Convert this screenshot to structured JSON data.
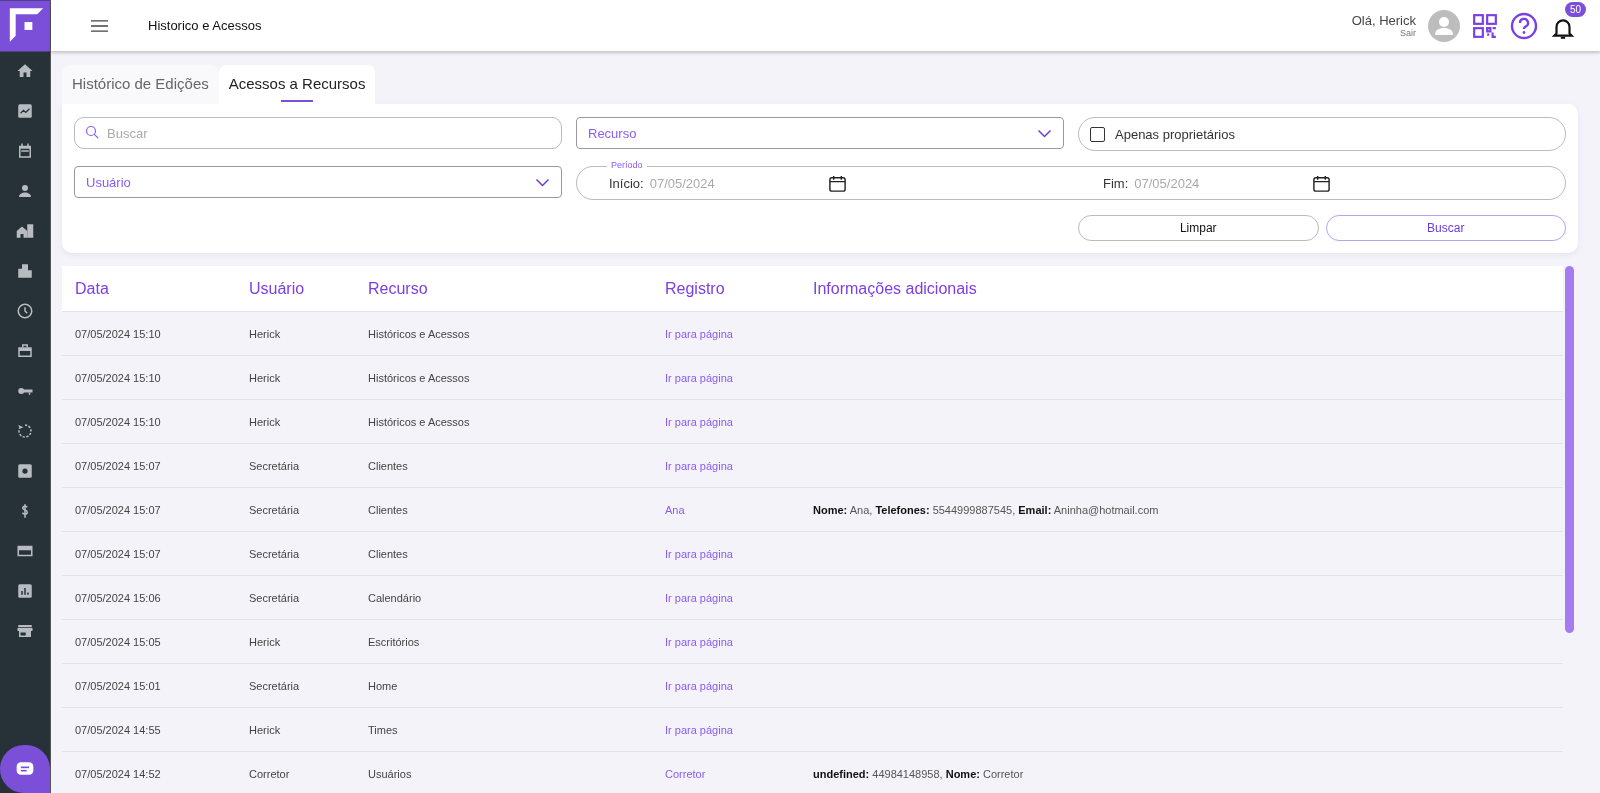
{
  "header": {
    "title": "Historico e Acessos",
    "greeting": "Olá, Herick",
    "logout": "Sair",
    "notifications": "50"
  },
  "tabs": [
    {
      "label": "Histórico de Edições",
      "selected": false
    },
    {
      "label": "Acessos a Recursos",
      "selected": true
    }
  ],
  "filters": {
    "search": {
      "placeholder": "Buscar"
    },
    "resource": {
      "label": "Recurso"
    },
    "owners_only": {
      "label": "Apenas proprietários",
      "checked": false
    },
    "user": {
      "label": "Usuário"
    },
    "period": {
      "legend": "Período",
      "start_label": "Início:",
      "start_value": "07/05/2024",
      "end_label": "Fim:",
      "end_value": "07/05/2024"
    },
    "buttons": [
      {
        "label": "Limpar",
        "kind": "secondary"
      },
      {
        "label": "Buscar",
        "kind": "primary"
      }
    ]
  },
  "table": {
    "columns": [
      "Data",
      "Usuário",
      "Recurso",
      "Registro",
      "Informações adicionais"
    ],
    "rows": [
      {
        "date": "07/05/2024 15:10",
        "user": "Herick",
        "resource": "Históricos e Acessos",
        "record": "Ir para página"
      },
      {
        "date": "07/05/2024 15:10",
        "user": "Herick",
        "resource": "Históricos e Acessos",
        "record": "Ir para página"
      },
      {
        "date": "07/05/2024 15:10",
        "user": "Herick",
        "resource": "Históricos e Acessos",
        "record": "Ir para página"
      },
      {
        "date": "07/05/2024 15:07",
        "user": "Secretária",
        "resource": "Clientes",
        "record": "Ir para página"
      },
      {
        "date": "07/05/2024 15:07",
        "user": "Secretária",
        "resource": "Clientes",
        "record": "Ana",
        "info": "**Nome:** Ana, **Telefones:** 5544999887545, **Email:** Aninha@hotmail.com"
      },
      {
        "date": "07/05/2024 15:07",
        "user": "Secretária",
        "resource": "Clientes",
        "record": "Ir para página"
      },
      {
        "date": "07/05/2024 15:06",
        "user": "Secretária",
        "resource": "Calendário",
        "record": "Ir para página"
      },
      {
        "date": "07/05/2024 15:05",
        "user": "Herick",
        "resource": "Escritórios",
        "record": "Ir para página"
      },
      {
        "date": "07/05/2024 15:01",
        "user": "Secretária",
        "resource": "Home",
        "record": "Ir para página"
      },
      {
        "date": "07/05/2024 14:55",
        "user": "Herick",
        "resource": "Times",
        "record": "Ir para página"
      },
      {
        "date": "07/05/2024 14:52",
        "user": "Corretor",
        "resource": "Usuários",
        "record": "Corretor",
        "info": "**undefined:** 44984148958, **Nome:** Corretor"
      }
    ]
  }
}
